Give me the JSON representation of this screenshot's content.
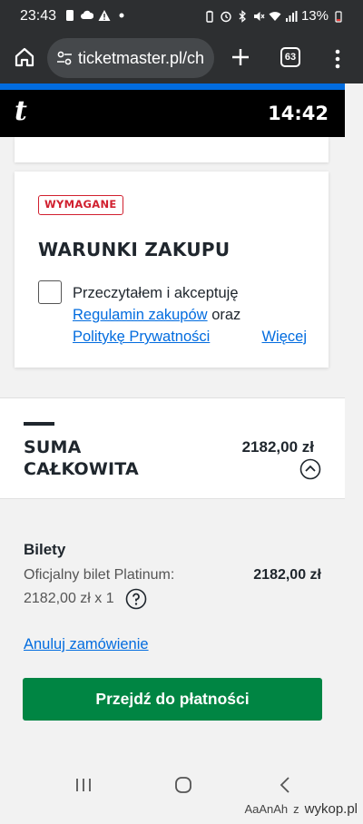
{
  "status_bar": {
    "time": "23:43",
    "battery": "13%",
    "left_icons": [
      "notification-icon",
      "cloud-icon",
      "warning-icon",
      "dot-icon"
    ],
    "right_icons": [
      "battery-saver-icon",
      "alarm-icon",
      "bluetooth-icon",
      "mute-icon",
      "wifi-icon",
      "signal-icon",
      "battery-icon"
    ]
  },
  "browser": {
    "url": "ticketmaster.pl/ch",
    "tab_count": "63"
  },
  "header": {
    "logo": "t",
    "timer": "14:42"
  },
  "terms_card": {
    "badge": "WYMAGANE",
    "title": "WARUNKI ZAKUPU",
    "text_before": "Przeczytałem i akceptuję",
    "link_regulations": "Regulamin zakupów",
    "text_and": "oraz",
    "link_privacy": "Politykę Prywatności",
    "link_more": "Więcej",
    "checked": false
  },
  "total": {
    "label_line1": "SUMA",
    "label_line2": "CAŁKOWITA",
    "amount": "2182,00 zł"
  },
  "tickets": {
    "title": "Bilety",
    "name": "Oficjalny bilet Platinum:",
    "unit_line": "2182,00 zł x 1",
    "amount": "2182,00 zł"
  },
  "actions": {
    "cancel": "Anuluj zamówienie",
    "pay": "Przejdź do płatności"
  },
  "watermark": {
    "user": "AaAnAh",
    "z": "z",
    "site": "wykop.pl"
  },
  "colors": {
    "accent": "#026cdf",
    "primary_button": "#008543",
    "required": "#d1202f"
  }
}
